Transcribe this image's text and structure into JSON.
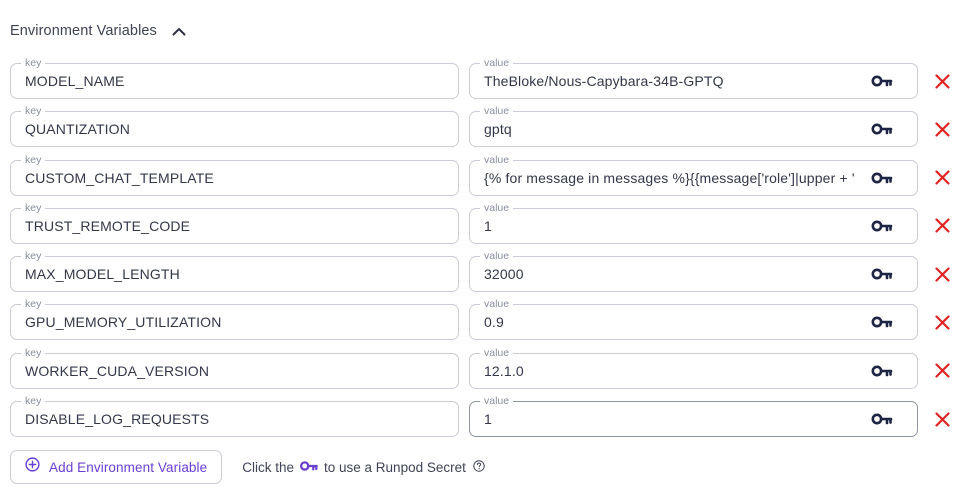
{
  "section": {
    "title": "Environment Variables",
    "expanded": true
  },
  "field_labels": {
    "key": "key",
    "value": "value"
  },
  "env_vars": [
    {
      "key": "MODEL_NAME",
      "value": "TheBloke/Nous-Capybara-34B-GPTQ"
    },
    {
      "key": "QUANTIZATION",
      "value": "gptq"
    },
    {
      "key": "CUSTOM_CHAT_TEMPLATE",
      "value": "{% for message in messages %}{{message['role']|upper + ': ' + message['content']}}{% endfor %}"
    },
    {
      "key": "TRUST_REMOTE_CODE",
      "value": "1"
    },
    {
      "key": "MAX_MODEL_LENGTH",
      "value": "32000"
    },
    {
      "key": "GPU_MEMORY_UTILIZATION",
      "value": "0.9"
    },
    {
      "key": "WORKER_CUDA_VERSION",
      "value": "12.1.0"
    },
    {
      "key": "DISABLE_LOG_REQUESTS",
      "value": "1"
    }
  ],
  "footer": {
    "add_button_label": "Add Environment Variable",
    "hint_prefix": "Click the",
    "hint_suffix": "to use a Runpod Secret"
  },
  "colors": {
    "accent": "#6a3fd4",
    "remove": "#e02424",
    "key_icon": "#1e2544",
    "border": "#c9ccd6"
  },
  "icons": {
    "collapse": "chevron-up-icon",
    "secret": "key-icon",
    "remove": "close-icon",
    "add": "plus-circle-icon",
    "help": "question-circle-icon"
  }
}
